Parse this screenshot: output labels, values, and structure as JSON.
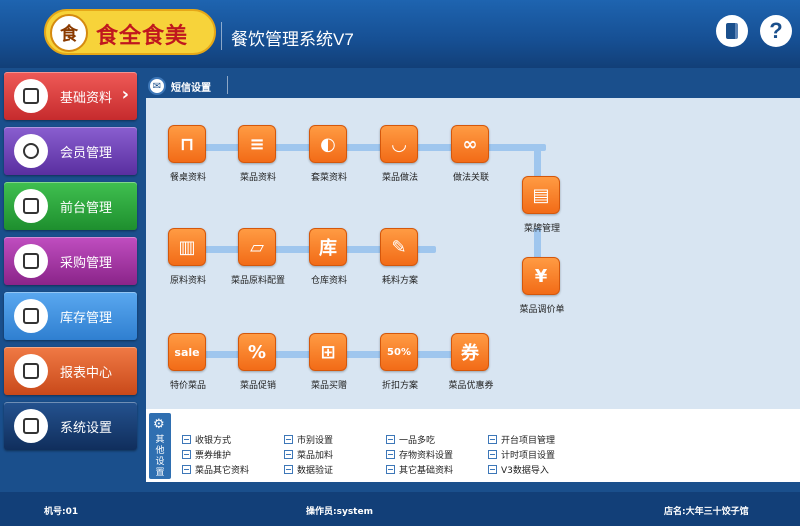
{
  "header": {
    "logo_glyph": "食",
    "logo_text": "食全食美",
    "app_title": "餐饮管理系统V7",
    "help_label": "?"
  },
  "sidebar": {
    "items": [
      {
        "label": "基础资料",
        "color": "#d93a3a",
        "active": true,
        "arrow": "›"
      },
      {
        "label": "会员管理",
        "color": "#6a3fb2"
      },
      {
        "label": "前台管理",
        "color": "#27a33a"
      },
      {
        "label": "采购管理",
        "color": "#a0309d"
      },
      {
        "label": "库存管理",
        "color": "#3d8fe0"
      },
      {
        "label": "报表中心",
        "color": "#e0602a"
      },
      {
        "label": "系统设置",
        "color": "#173d7a"
      }
    ]
  },
  "tab": {
    "label": "短信设置",
    "icon": "message-icon"
  },
  "flow": {
    "row1": [
      "餐桌资料",
      "菜品资料",
      "套菜资料",
      "菜品做法",
      "做法关联"
    ],
    "row2": [
      "原料资料",
      "菜品原料配置",
      "仓库资料",
      "耗料方案"
    ],
    "row3": [
      "特价菜品",
      "菜品促销",
      "菜品买赠",
      "折扣方案",
      "菜品优惠券"
    ],
    "side": [
      "菜牌管理",
      "菜品调价单"
    ],
    "glyphs": {
      "sale": "sale",
      "percent": "%",
      "warehouse": "库",
      "discount": "50%",
      "coupon": "券",
      "price": "¥"
    }
  },
  "other": {
    "label": "其他设置",
    "links": [
      [
        "收银方式",
        "市别设置",
        "一品多吃",
        "开台项目管理"
      ],
      [
        "票券维护",
        "菜品加料",
        "存物资料设置",
        "计时项目设置"
      ],
      [
        "菜品其它资料",
        "数据验证",
        "其它基础资料",
        "V3数据导入"
      ]
    ]
  },
  "footer": {
    "machine": "机号:01",
    "operator": "操作员:system",
    "store": "店名:大年三十饺子馆"
  },
  "colors": {
    "accent": "#1a4f8c",
    "node": "#f26b17",
    "connector": "#9fc6ee"
  }
}
